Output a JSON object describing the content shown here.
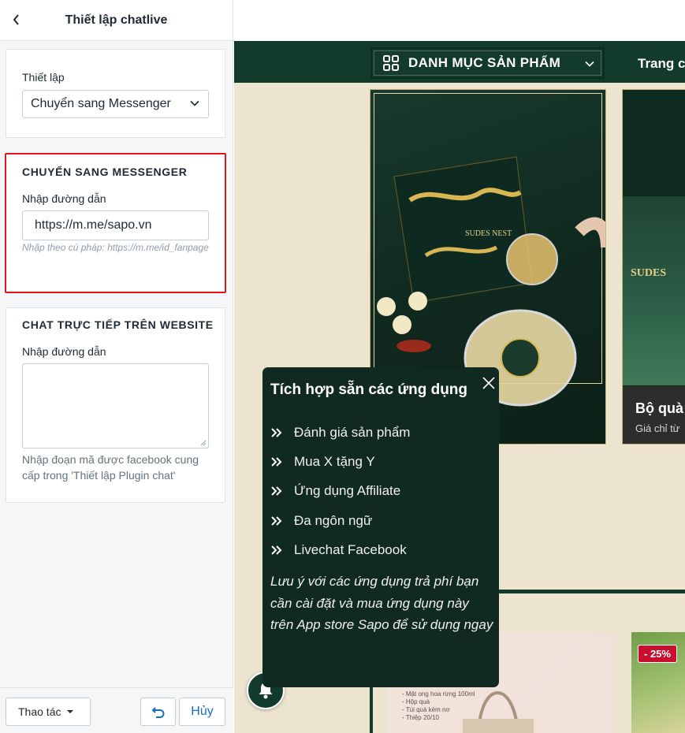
{
  "panel": {
    "title": "Thiết lập chatlive"
  },
  "settings_card": {
    "label": "Thiết lập",
    "select_value": "Chuyển sang Messenger"
  },
  "messenger_card": {
    "heading": "CHUYỂN SANG MESSENGER",
    "label": "Nhập đường dẫn",
    "input_value": "https://m.me/sapo.vn",
    "help": "Nhập theo cú pháp: https://m.me/id_fanpage"
  },
  "website_chat_card": {
    "heading": "CHAT TRỰC TIẾP TRÊN WEBSITE",
    "label": "Nhập đường dẫn",
    "textarea_value": "",
    "help": "Nhập đoạn mã được facebook cung cấp trong 'Thiết lập Plugin chat'"
  },
  "footer": {
    "actions_label": "Thao tác",
    "cancel_label": "Hủy"
  },
  "preview": {
    "category_button": "DANH MỤC SẢN PHẨM",
    "nav_link": "Trang c",
    "banner2_title": "Bộ quà",
    "banner2_sub": "Giá chỉ từ",
    "brand_text": "SUDES NEST",
    "brand_text_2": "SUDES",
    "product_list": [
      "- Mật ong hoa rừng 100ml",
      "- Hộp quà",
      "- Túi quà kèm nơ",
      "- Thiệp 20/10"
    ],
    "sale_badge": "- 25%"
  },
  "popup": {
    "title": "Tích hợp sẵn các ứng dụng",
    "items": [
      "Đánh giá sản phẩm",
      "Mua X tặng Y",
      "Ứng dụng Affiliate",
      "Đa ngôn ngữ",
      "Livechat Facebook"
    ],
    "note": "Lưu ý với các ứng dụng trả phí bạn cần cài đặt và mua ứng dụng này trên App store Sapo để sử dụng ngay"
  },
  "colors": {
    "nav_green": "#133b2c",
    "popup_bg": "#102a21",
    "highlight_red": "#e0161b",
    "cream_bg": "#ede4cf",
    "link_blue": "#1a6ec2"
  },
  "icons": [
    "back-chevron-icon",
    "chevron-down-icon",
    "grid-icon",
    "close-icon",
    "double-chevron-right-icon",
    "bell-icon",
    "undo-icon",
    "caret-down-icon"
  ]
}
